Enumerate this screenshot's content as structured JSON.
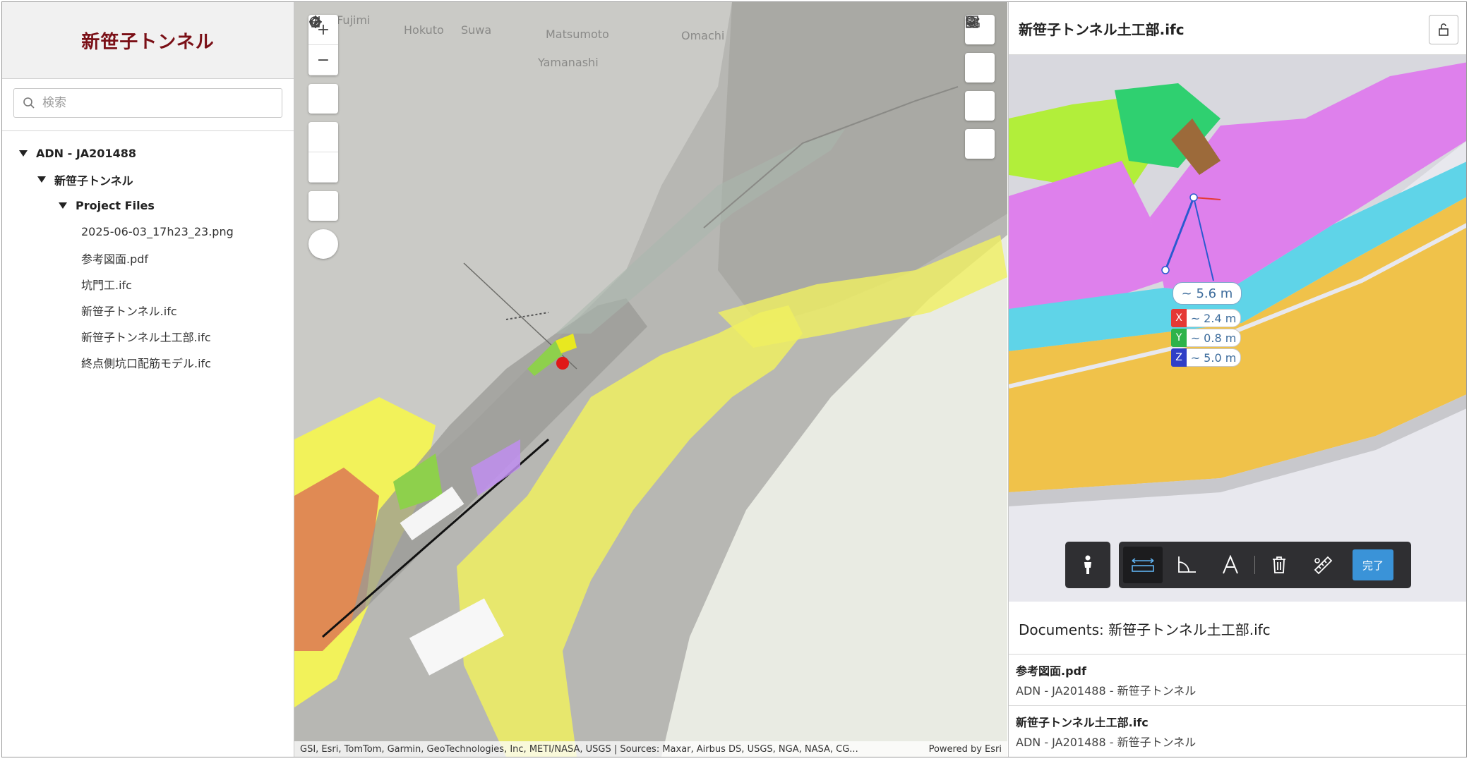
{
  "left": {
    "title": "新笹子トンネル",
    "search_placeholder": "検索",
    "tree": {
      "root": "ADN - JA201488",
      "project": "新笹子トンネル",
      "folder": "Project Files",
      "files": [
        "2025-06-03_17h23_23.png",
        "参考図面.pdf",
        "坑門工.ifc",
        "新笹子トンネル.ifc",
        "新笹子トンネル土工部.ifc",
        "終点側坑口配筋モデル.ifc"
      ]
    }
  },
  "map": {
    "places": [
      "Fujimi",
      "Hokuto",
      "Suwa",
      "Matsumoto",
      "Omachi",
      "Yamanashi"
    ],
    "attribution": "GSI, Esri, TomTom, Garmin, GeoTechnologies, Inc, METI/NASA, USGS | Sources: Maxar, Airbus DS, USGS, NGA, NASA, CG...",
    "powered_by": "Powered by Esri",
    "zoom_in": "+",
    "zoom_out": "−"
  },
  "right": {
    "title": "新笹子トンネル土工部.ifc",
    "measure": {
      "total": "~ 5.6 m",
      "x_key": "X",
      "x": "~ 2.4 m",
      "y_key": "Y",
      "y": "~ 0.8 m",
      "z_key": "Z",
      "z": "~ 5.0 m"
    },
    "done_label": "完了",
    "documents_title": "Documents: 新笹子トンネル土工部.ifc",
    "documents": [
      {
        "name": "参考図面.pdf",
        "path": "ADN - JA201488 - 新笹子トンネル"
      },
      {
        "name": "新笹子トンネル土工部.ifc",
        "path": "ADN - JA201488 - 新笹子トンネル"
      }
    ]
  },
  "colors": {
    "title_red": "#7a0f16",
    "accent_blue": "#3a93d8",
    "axis_x": "#e53935",
    "axis_y": "#2eb34a",
    "axis_z": "#2f3fc7"
  }
}
